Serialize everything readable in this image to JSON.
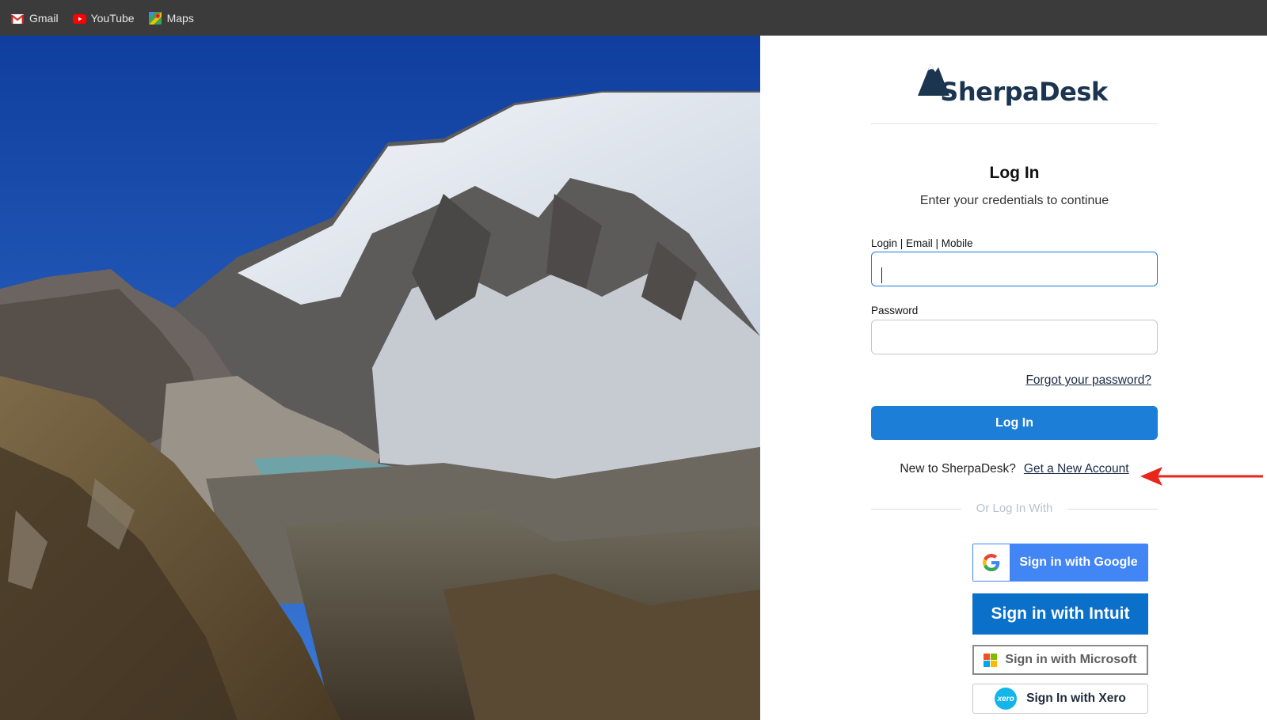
{
  "bookmarks": [
    {
      "label": "Gmail",
      "icon": "gmail-icon"
    },
    {
      "label": "YouTube",
      "icon": "youtube-icon"
    },
    {
      "label": "Maps",
      "icon": "maps-icon"
    }
  ],
  "hero": {
    "description_icon": "mountain-photo",
    "alt": ""
  },
  "brand": {
    "name": "SherpaDesk"
  },
  "login": {
    "title": "Log In",
    "subtitle": "Enter your credentials to continue",
    "login_label": "Login | Email | Mobile",
    "login_value": "",
    "password_label": "Password",
    "password_value": "",
    "forgot_label": "Forgot your password?",
    "submit_label": "Log In",
    "new_prompt": "New to SherpaDesk?",
    "new_account_label": "Get a New Account",
    "or_label": "Or Log In With"
  },
  "sso": {
    "google": "Sign in with Google",
    "intuit": "Sign in with Intuit",
    "microsoft": "Sign in with Microsoft",
    "xero": "Sign In with Xero",
    "xero_logo_text": "xero"
  },
  "colors": {
    "primary": "#1c7ed6",
    "bookmarks_bg": "#3b3b3b",
    "annotation_arrow": "#e8261c",
    "brand_navy": "#1b3550"
  }
}
